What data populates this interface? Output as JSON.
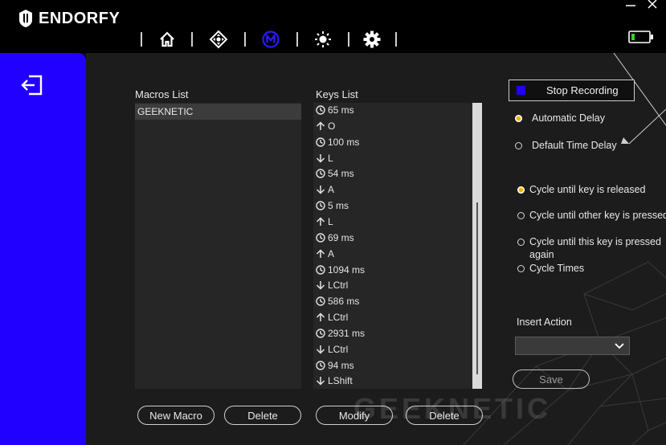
{
  "app": {
    "logo_text": "ENDORFY"
  },
  "nav": {
    "items": [
      "home-icon",
      "dpi-icon",
      "macro-icon",
      "lighting-icon",
      "settings-icon"
    ],
    "active": "macro-icon"
  },
  "colors": {
    "accent": "#2200ff",
    "radio_selected": "#f2b400",
    "battery": "#3ad12a"
  },
  "macros": {
    "label": "Macros List",
    "items": [
      "GEEKNETIC"
    ],
    "new_button": "New Macro",
    "delete_button": "Delete"
  },
  "keys": {
    "label": "Keys List",
    "items": [
      {
        "icon": "clock-icon",
        "text": "65 ms"
      },
      {
        "icon": "key-up-icon",
        "text": "O"
      },
      {
        "icon": "clock-icon",
        "text": "100 ms"
      },
      {
        "icon": "key-down-icon",
        "text": "L"
      },
      {
        "icon": "clock-icon",
        "text": "54 ms"
      },
      {
        "icon": "key-down-icon",
        "text": "A"
      },
      {
        "icon": "clock-icon",
        "text": "5 ms"
      },
      {
        "icon": "key-up-icon",
        "text": "L"
      },
      {
        "icon": "clock-icon",
        "text": "69 ms"
      },
      {
        "icon": "key-up-icon",
        "text": "A"
      },
      {
        "icon": "clock-icon",
        "text": "1094 ms"
      },
      {
        "icon": "key-down-icon",
        "text": "LCtrl"
      },
      {
        "icon": "clock-icon",
        "text": "586 ms"
      },
      {
        "icon": "key-up-icon",
        "text": "LCtrl"
      },
      {
        "icon": "clock-icon",
        "text": "2931 ms"
      },
      {
        "icon": "key-down-icon",
        "text": "LCtrl"
      },
      {
        "icon": "clock-icon",
        "text": "94 ms"
      },
      {
        "icon": "key-down-icon",
        "text": "LShift"
      }
    ],
    "modify_button": "Modify",
    "delete_button": "Delete"
  },
  "recording": {
    "stop_label": "Stop Recording"
  },
  "delay": {
    "automatic": "Automatic  Delay",
    "default": "Default Time Delay",
    "selected": "automatic"
  },
  "cycle": {
    "released": "Cycle until key is released",
    "other": "Cycle until other key is pressed",
    "this_line1": "Cycle until this key is pressed",
    "this_line2": "again",
    "times": "Cycle Times",
    "selected": "released"
  },
  "insert": {
    "label": "Insert Action",
    "value": ""
  },
  "save_button": "Save",
  "watermark": "GEEKNETIC"
}
